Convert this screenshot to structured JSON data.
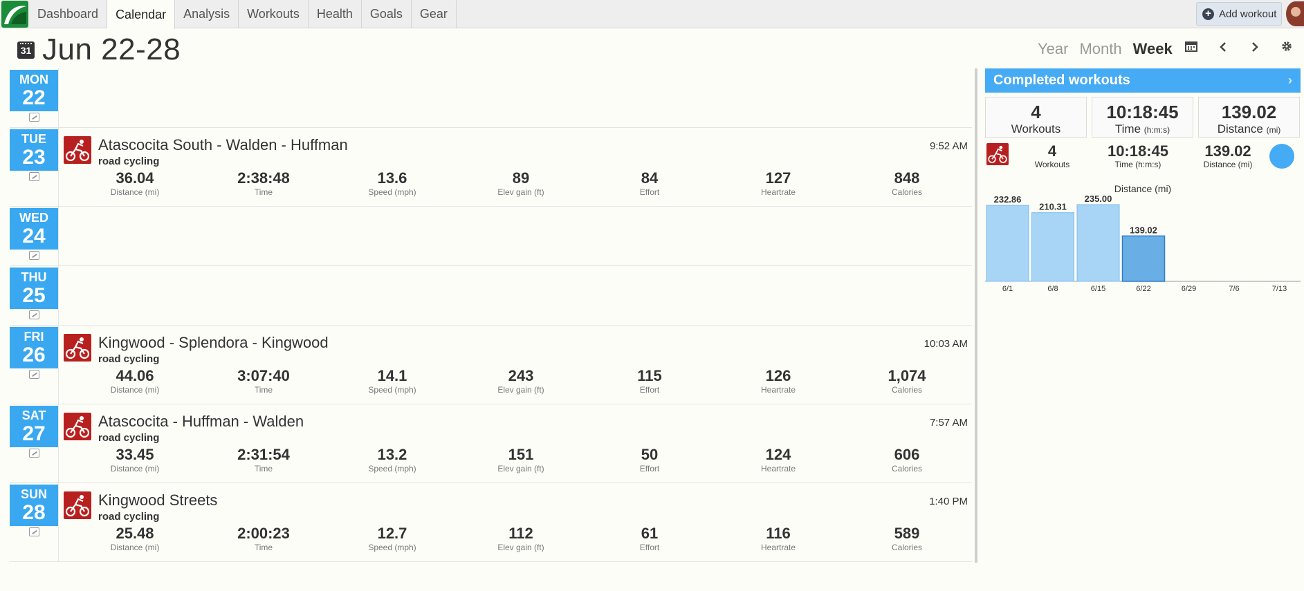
{
  "nav": {
    "tabs": [
      {
        "label": "Dashboard",
        "active": false
      },
      {
        "label": "Calendar",
        "active": true
      },
      {
        "label": "Analysis",
        "active": false
      },
      {
        "label": "Workouts",
        "active": false
      },
      {
        "label": "Health",
        "active": false
      },
      {
        "label": "Goals",
        "active": false
      },
      {
        "label": "Gear",
        "active": false
      }
    ],
    "add_workout": "Add workout"
  },
  "header": {
    "calendar_icon_text": "31",
    "title": "Jun 22-28",
    "views": [
      {
        "label": "Year",
        "active": false
      },
      {
        "label": "Month",
        "active": false
      },
      {
        "label": "Week",
        "active": true
      }
    ]
  },
  "colors": {
    "accent": "#39a8f0",
    "sport": "#b8201f",
    "bar": "#a8d4f5",
    "bar_current": "#6aaee6"
  },
  "stat_labels": [
    "Distance (mi)",
    "Time",
    "Speed (mph)",
    "Elev gain (ft)",
    "Effort",
    "Heartrate",
    "Calories"
  ],
  "days": [
    {
      "dow": "MON",
      "date": "22",
      "workouts": []
    },
    {
      "dow": "TUE",
      "date": "23",
      "workouts": [
        {
          "title": "Atascocita South - Walden - Huffman",
          "type": "road cycling",
          "time": "9:52 AM",
          "stats": [
            "36.04",
            "2:38:48",
            "13.6",
            "89",
            "84",
            "127",
            "848"
          ]
        }
      ]
    },
    {
      "dow": "WED",
      "date": "24",
      "workouts": []
    },
    {
      "dow": "THU",
      "date": "25",
      "workouts": []
    },
    {
      "dow": "FRI",
      "date": "26",
      "workouts": [
        {
          "title": "Kingwood - Splendora - Kingwood",
          "type": "road cycling",
          "time": "10:03 AM",
          "stats": [
            "44.06",
            "3:07:40",
            "14.1",
            "243",
            "115",
            "126",
            "1,074"
          ]
        }
      ]
    },
    {
      "dow": "SAT",
      "date": "27",
      "workouts": [
        {
          "title": "Atascocita - Huffman - Walden",
          "type": "road cycling",
          "time": "7:57 AM",
          "stats": [
            "33.45",
            "2:31:54",
            "13.2",
            "151",
            "50",
            "124",
            "606"
          ]
        }
      ]
    },
    {
      "dow": "SUN",
      "date": "28",
      "workouts": [
        {
          "title": "Kingwood Streets",
          "type": "road cycling",
          "time": "1:40 PM",
          "stats": [
            "25.48",
            "2:00:23",
            "12.7",
            "112",
            "61",
            "116",
            "589"
          ]
        }
      ]
    }
  ],
  "sidebar": {
    "title": "Completed workouts",
    "chevron": "›",
    "summary": [
      {
        "value": "4",
        "label": "Workouts",
        "unit": ""
      },
      {
        "value": "10:18:45",
        "label": "Time",
        "unit": "(h:m:s)"
      },
      {
        "value": "139.02",
        "label": "Distance",
        "unit": "(mi)"
      }
    ],
    "sport_summary": [
      {
        "value": "4",
        "label": "Workouts"
      },
      {
        "value": "10:18:45",
        "label": "Time (h:m:s)"
      },
      {
        "value": "139.02",
        "label": "Distance (mi)"
      }
    ]
  },
  "chart_data": {
    "type": "bar",
    "title": "Distance (mi)",
    "categories": [
      "6/1",
      "6/8",
      "6/15",
      "6/22",
      "6/29",
      "7/6",
      "7/13"
    ],
    "values": [
      232.86,
      210.31,
      235.0,
      139.02,
      null,
      null,
      null
    ],
    "labels": [
      "232.86",
      "210.31",
      "235.00",
      "139.02",
      "",
      "",
      ""
    ],
    "highlight_index": 3,
    "ylim": [
      0,
      235
    ]
  }
}
